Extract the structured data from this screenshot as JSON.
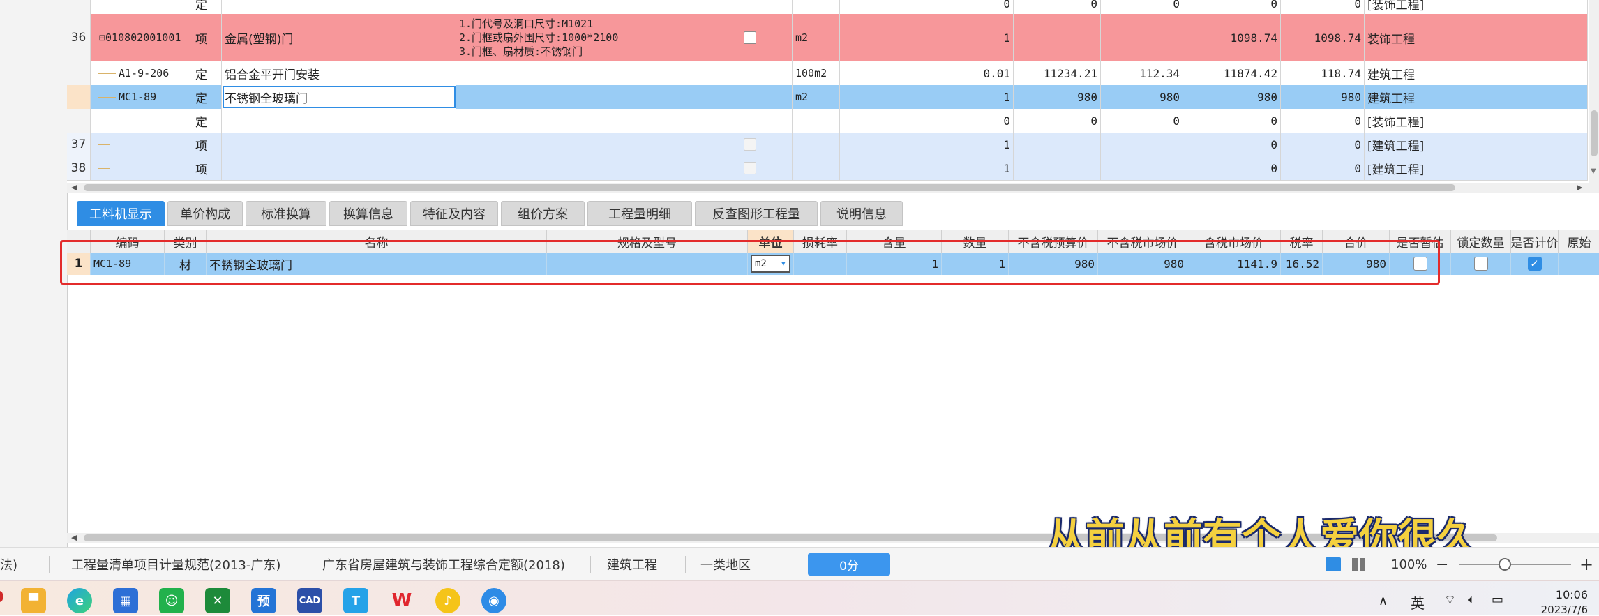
{
  "upper_grid": {
    "rows": [
      {
        "row_no": "",
        "code": "",
        "type": "定",
        "name": "",
        "desc": [],
        "unit": "",
        "qty": "0",
        "p1": "0",
        "p2": "0",
        "p3": "0",
        "total": "0",
        "category": "[装饰工程]",
        "style": "plain"
      },
      {
        "row_no": "36",
        "code": "010802001001",
        "type": "项",
        "name": "金属(塑钢)门",
        "desc": [
          "1.门代号及洞口尺寸:M1021",
          "2.门框或扇外围尺寸:1000*2100",
          "3.门框、扇材质:不锈钢门"
        ],
        "unit": "m2",
        "qty": "1",
        "p1": "",
        "p2": "",
        "p3": "1098.74",
        "total": "1098.74",
        "category": "装饰工程",
        "style": "red"
      },
      {
        "row_no": "",
        "code": "A1-9-206",
        "type": "定",
        "name": "铝合金平开门安装",
        "desc": [],
        "unit": "100m2",
        "qty": "0.01",
        "p1": "11234.21",
        "p2": "112.34",
        "p3": "11874.42",
        "total": "118.74",
        "category": "建筑工程",
        "style": "plain"
      },
      {
        "row_no": "",
        "code": "MC1-89",
        "type": "定",
        "name": "不锈钢全玻璃门",
        "desc": [],
        "unit": "m2",
        "qty": "1",
        "p1": "980",
        "p2": "980",
        "p3": "980",
        "total": "980",
        "category": "建筑工程",
        "style": "selected"
      },
      {
        "row_no": "",
        "code": "",
        "type": "定",
        "name": "",
        "desc": [],
        "unit": "",
        "qty": "0",
        "p1": "0",
        "p2": "0",
        "p3": "0",
        "total": "0",
        "category": "[装饰工程]",
        "style": "plain"
      },
      {
        "row_no": "37",
        "code": "",
        "type": "项",
        "name": "",
        "desc": [],
        "unit": "",
        "qty": "1",
        "p1": "",
        "p2": "",
        "p3": "0",
        "total": "0",
        "category": "[建筑工程]",
        "style": "light"
      },
      {
        "row_no": "38",
        "code": "",
        "type": "项",
        "name": "",
        "desc": [],
        "unit": "",
        "qty": "1",
        "p1": "",
        "p2": "",
        "p3": "0",
        "total": "0",
        "category": "[建筑工程]",
        "style": "light"
      }
    ]
  },
  "tabs": [
    "工料机显示",
    "单价构成",
    "标准换算",
    "换算信息",
    "特征及内容",
    "组价方案",
    "工程量明细",
    "反查图形工程量",
    "说明信息"
  ],
  "lower_grid": {
    "headers": [
      "编码",
      "类别",
      "名称",
      "规格及型号",
      "单位",
      "损耗率",
      "含量",
      "数量",
      "不含税预算价",
      "不含税市场价",
      "含税市场价",
      "税率",
      "合价",
      "是否暂估",
      "锁定数量",
      "是否计价",
      "原始"
    ],
    "row": {
      "index": "1",
      "code": "MC1-89",
      "category": "材",
      "name": "不锈钢全玻璃门",
      "spec": "",
      "unit": "m2",
      "loss_rate": "",
      "content": "1",
      "quantity": "1",
      "budget_price": "980",
      "market_price": "980",
      "tax_market_price": "1141.9",
      "tax_rate": "16.52",
      "total": "980",
      "is_estimate": false,
      "lock_qty": false,
      "is_priced": true
    }
  },
  "status_bar": {
    "method": "法)",
    "spec": "工程量清单项目计量规范(2013-广东)",
    "quota": "广东省房屋建筑与装饰工程综合定额(2018)",
    "discipline": "建筑工程",
    "region": "一类地区",
    "score": "0分",
    "zoom": "100%"
  },
  "subtitle": "从前从前有个人爱你很久",
  "taskbar": {
    "apps": [
      "file-explorer",
      "edge",
      "store",
      "wechat",
      "xbox",
      "yu",
      "cad",
      "t-app",
      "wps",
      "music",
      "browser"
    ],
    "app_labels": {
      "yu": "预",
      "cad": "CAD",
      "t": "T",
      "wps": "W"
    },
    "ime": "英",
    "time": "10:06",
    "date": "2023/7/6"
  },
  "colors": {
    "accent": "#2f8de4",
    "red_row": "#f7979a",
    "selected_row": "#99ccf5",
    "light_row": "#dce9fb",
    "highlight": "#e32b2b"
  }
}
